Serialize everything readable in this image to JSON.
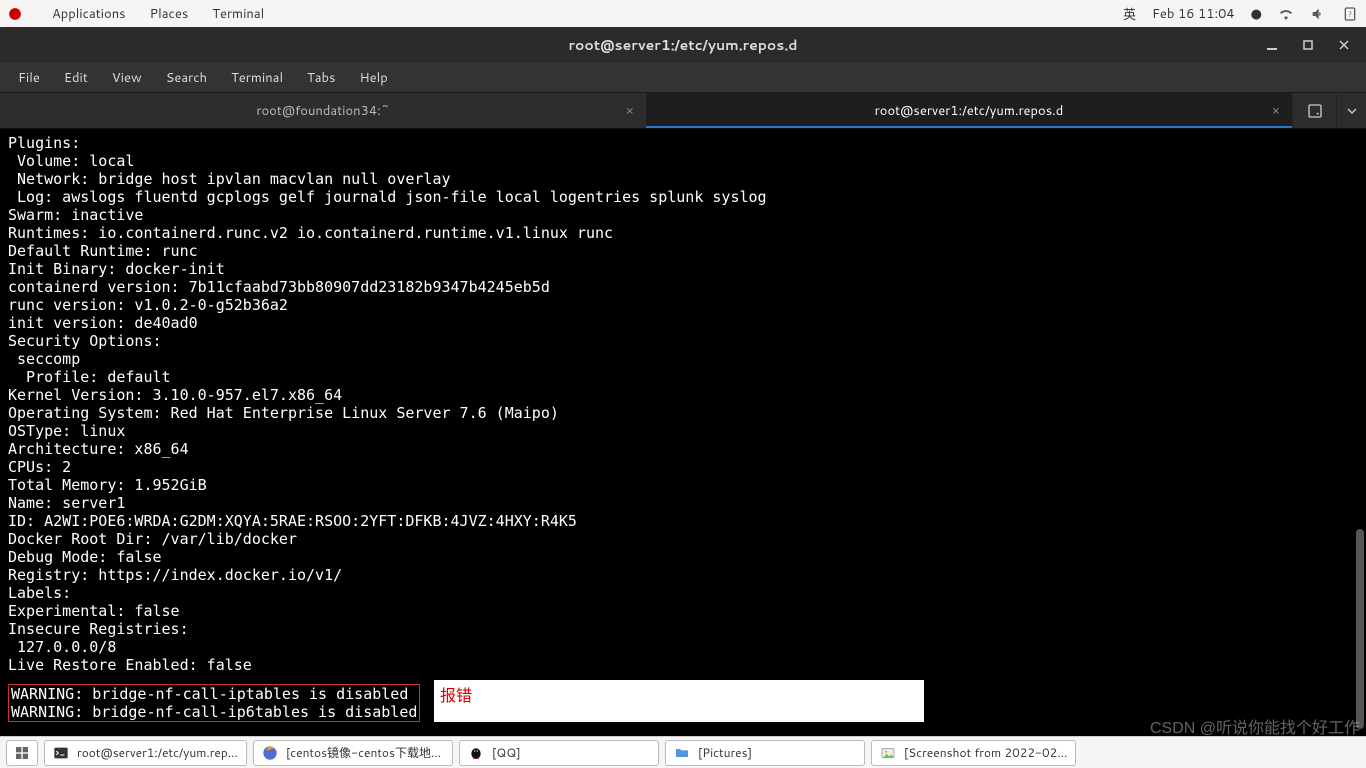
{
  "topbar": {
    "apps": [
      "Applications",
      "Places",
      "Terminal"
    ],
    "ime": "英",
    "clock": "Feb 16  11:04"
  },
  "window": {
    "title": "root@server1:/etc/yum.repos.d"
  },
  "menubar": [
    "File",
    "Edit",
    "View",
    "Search",
    "Terminal",
    "Tabs",
    "Help"
  ],
  "tabs": [
    {
      "label": "root@foundation34:~",
      "active": false
    },
    {
      "label": "root@server1:/etc/yum.repos.d",
      "active": true
    }
  ],
  "terminal_output": "Plugins:\n Volume: local\n Network: bridge host ipvlan macvlan null overlay\n Log: awslogs fluentd gcplogs gelf journald json-file local logentries splunk syslog\nSwarm: inactive\nRuntimes: io.containerd.runc.v2 io.containerd.runtime.v1.linux runc\nDefault Runtime: runc\nInit Binary: docker-init\ncontainerd version: 7b11cfaabd73bb80907dd23182b9347b4245eb5d\nrunc version: v1.0.2-0-g52b36a2\ninit version: de40ad0\nSecurity Options:\n seccomp\n  Profile: default\nKernel Version: 3.10.0-957.el7.x86_64\nOperating System: Red Hat Enterprise Linux Server 7.6 (Maipo)\nOSType: linux\nArchitecture: x86_64\nCPUs: 2\nTotal Memory: 1.952GiB\nName: server1\nID: A2WI:POE6:WRDA:G2DM:XQYA:5RAE:RSOO:2YFT:DFKB:4JVZ:4HXY:R4K5\nDocker Root Dir: /var/lib/docker\nDebug Mode: false\nRegistry: https://index.docker.io/v1/\nLabels:\nExperimental: false\nInsecure Registries:\n 127.0.0.0/8\nLive Restore Enabled: false",
  "warnings": "WARNING: bridge-nf-call-iptables is disabled\nWARNING: bridge-nf-call-ip6tables is disabled",
  "note_label": "报错",
  "watermark": "CSDN @听说你能找个好工作",
  "taskbar": {
    "items": [
      {
        "label": "root@server1:/etc/yum.rep...",
        "icon": "terminal"
      },
      {
        "label": "[centos镜像-centos下载地...",
        "icon": "firefox"
      },
      {
        "label": "[QQ]",
        "icon": "qq"
      },
      {
        "label": "[Pictures]",
        "icon": "folder"
      },
      {
        "label": "[Screenshot from 2022-02...",
        "icon": "image"
      }
    ]
  }
}
